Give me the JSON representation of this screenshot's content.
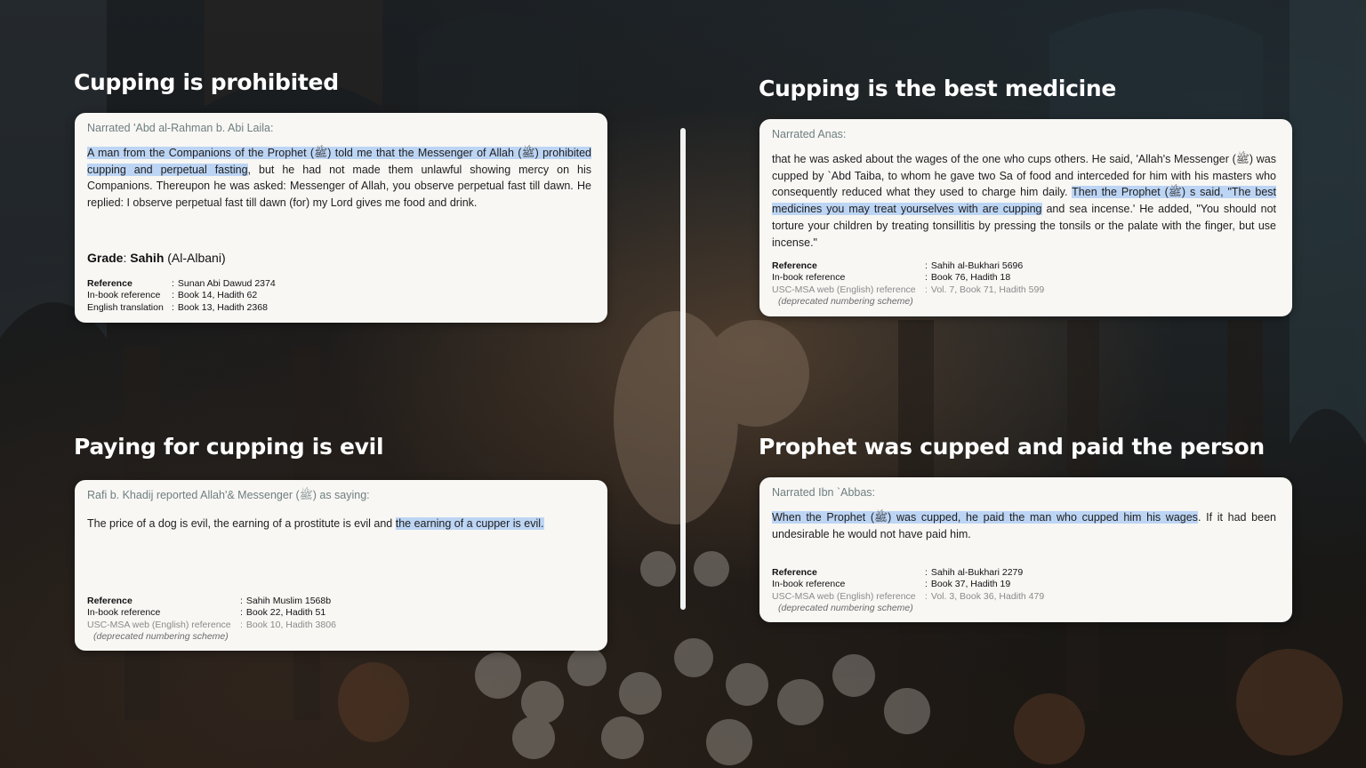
{
  "colors": {
    "highlight": "#bdd5f4",
    "card_background": "#f8f7f4",
    "narrator_text": "#6f7e80",
    "title_text": "#ffffff"
  },
  "sections": {
    "top_left": {
      "title": "Cupping is prohibited",
      "narrator": "Narrated 'Abd al-Rahman b. Abi Laila:",
      "text_hl": "A man from the Companions of the Prophet (ﷺ) told me that the Messenger of Allah (ﷺ) prohibited cupping and perpetual fasting",
      "text_rest": ", but he had not made them unlawful showing mercy on his Companions. Thereupon he was asked: Messenger of Allah, you observe perpetual fast till dawn. He replied: I observe perpetual fast till dawn (for) my Lord gives me food and drink.",
      "grade_label": "Grade",
      "grade_value": "Sahih",
      "grade_source": "(Al-Albani)",
      "refs": [
        {
          "key": "Reference",
          "value": "Sunan Abi Dawud 2374"
        },
        {
          "key": "In-book reference",
          "value": "Book 14, Hadith 62"
        },
        {
          "key": "English translation",
          "value": "Book 13, Hadith 2368"
        }
      ]
    },
    "top_right": {
      "title": "Cupping is the best medicine",
      "narrator": "Narrated Anas:",
      "text_pre": "that he was asked about the wages of the one who cups others. He said, 'Allah's Messenger (ﷺ) was cupped by `Abd Taiba, to whom he gave two Sa of food and interceded for him with his masters who consequently reduced what they used to charge him daily. ",
      "text_hl": "Then the Prophet (ﷺ) s said, \"The best medicines you may treat yourselves with are cupping",
      "text_post": " and sea incense.' He added, \"You should not torture your children by treating tonsillitis by pressing the tonsils or the palate with the finger, but use incense.\"",
      "refs": [
        {
          "key": "Reference",
          "value": "Sahih al-Bukhari 5696"
        },
        {
          "key": "In-book reference",
          "value": "Book 76, Hadith 18"
        },
        {
          "key": "USC-MSA web (English) reference",
          "value": "Vol. 7, Book 71, Hadith 599"
        }
      ],
      "deprecated": "(deprecated numbering scheme)"
    },
    "bottom_left": {
      "title": "Paying for cupping is evil",
      "narrator": "Rafi b. Khadij reported Allah'& Messenger (ﷺ) as saying:",
      "text_pre": "The price of a dog is evil, the earning of a prostitute is evil and ",
      "text_hl": "the earning of a cupper is evil.",
      "refs": [
        {
          "key": "Reference",
          "value": "Sahih Muslim 1568b"
        },
        {
          "key": "In-book reference",
          "value": "Book 22, Hadith 51"
        },
        {
          "key": "USC-MSA web (English) reference",
          "value": "Book 10, Hadith 3806"
        }
      ],
      "deprecated": "(deprecated numbering scheme)"
    },
    "bottom_right": {
      "title": "Prophet was cupped and paid the person",
      "narrator": "Narrated Ibn `Abbas:",
      "text_hl": "When the Prophet (ﷺ) was cupped, he paid the man who cupped him his wages",
      "text_rest": ". If it had been undesirable he would not have paid him.",
      "refs": [
        {
          "key": "Reference",
          "value": "Sahih al-Bukhari 2279"
        },
        {
          "key": "In-book reference",
          "value": "Book 37, Hadith 19"
        },
        {
          "key": "USC-MSA web (English) reference",
          "value": "Vol. 3, Book 36, Hadith 479"
        }
      ],
      "deprecated": "(deprecated numbering scheme)"
    }
  }
}
